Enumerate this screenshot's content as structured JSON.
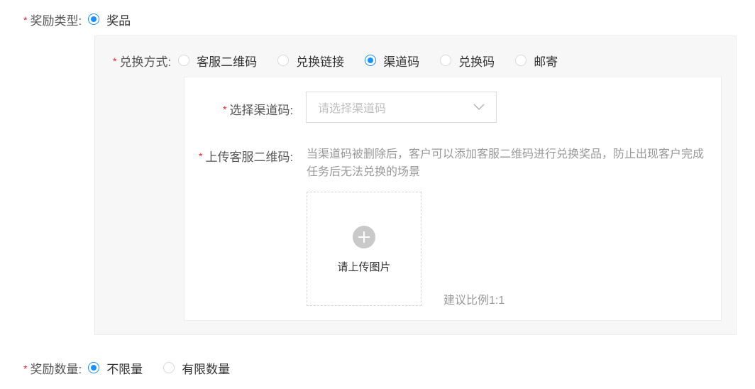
{
  "reward_type": {
    "label": "奖励类型:",
    "options": [
      "奖品"
    ],
    "selected": "奖品"
  },
  "redeem_method": {
    "label": "兑换方式:",
    "options": [
      "客服二维码",
      "兑换链接",
      "渠道码",
      "兑换码",
      "邮寄"
    ],
    "selected": "渠道码"
  },
  "channel_code": {
    "label": "选择渠道码:",
    "placeholder": "请选择渠道码"
  },
  "upload_qr": {
    "label": "上传客服二维码:",
    "hint": "当渠道码被删除后，客户可以添加客服二维码进行兑换奖品，防止出现客户完成任务后无法兑换的场景",
    "upload_text": "请上传图片",
    "ratio_text": "建议比例1:1"
  },
  "reward_quantity": {
    "label": "奖励数量:",
    "options": [
      "不限量",
      "有限数量"
    ],
    "selected": "不限量"
  },
  "required_mark": "*",
  "colors": {
    "primary": "#1890ff",
    "required": "#f5222d",
    "panel_bg": "#f7f7f7"
  }
}
